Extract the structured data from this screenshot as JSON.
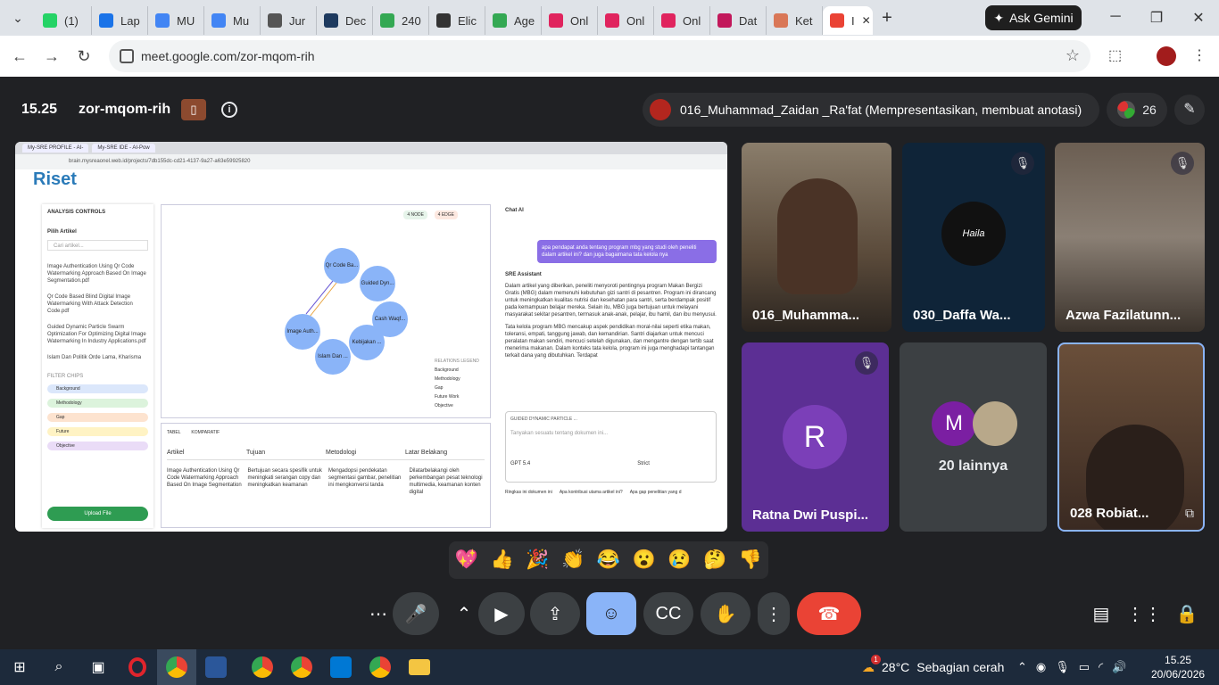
{
  "browser": {
    "tabs": [
      {
        "label": "(1)",
        "icon": "whatsapp-icon",
        "color": "#25d366"
      },
      {
        "label": "Lap",
        "icon": "drive-icon",
        "color": "#1a73e8"
      },
      {
        "label": "MU",
        "icon": "docs-icon",
        "color": "#4285f4"
      },
      {
        "label": "Mu",
        "icon": "docs-icon",
        "color": "#4285f4"
      },
      {
        "label": "Jur",
        "icon": "journal-icon",
        "color": "#555555"
      },
      {
        "label": "Dec",
        "icon": "shield-icon",
        "color": "#1e3a5f"
      },
      {
        "label": "240",
        "icon": "emoji-icon",
        "color": "#34a853"
      },
      {
        "label": "Elic",
        "icon": "elicit-icon",
        "color": "#333333"
      },
      {
        "label": "Age",
        "icon": "emoji-icon",
        "color": "#34a853"
      },
      {
        "label": "Onl",
        "icon": "v-icon",
        "color": "#e0245e"
      },
      {
        "label": "Onl",
        "icon": "v-icon",
        "color": "#e0245e"
      },
      {
        "label": "Onl",
        "icon": "v-icon",
        "color": "#e0245e"
      },
      {
        "label": "Dat",
        "icon": "m-icon",
        "color": "#c2185b"
      },
      {
        "label": "Ket",
        "icon": "spark-icon",
        "color": "#d97757"
      },
      {
        "label": "I",
        "icon": "record-icon",
        "color": "#ea4335",
        "active": true
      }
    ],
    "new_tab_glyph": "+",
    "gemini_label": "Ask Gemini",
    "url": "meet.google.com/zor-mqom-rih"
  },
  "meet": {
    "time": "15.25",
    "meeting_code": "zor-mqom-rih",
    "presenter_label": "016_Muhammad_Zaidan _Ra'fat (Mempresentasikan, membuat anotasi)",
    "people_count": "26"
  },
  "shared_screen": {
    "browser_tabs": [
      "My-SRE PROFILE - AI-",
      "My-SRE IDE - AI-Pow"
    ],
    "url": "brain.mysreaonel.web.id/projects/7db155dc-cd21-4137-9a27-a63e59925820",
    "logo": "Riset",
    "sidebar": {
      "title": "ANALYSIS CONTROLS",
      "pick_label": "Pilih Artikel",
      "search_placeholder": "Cari artikel...",
      "articles": [
        "Image Authentication Using Qr Code Watermarking Approach Based On Image Segmentation.pdf",
        "Qr Code Based Blind Digital Image Watermarking With Attack Detection Code.pdf",
        "Guided Dynamic Particle Swarm Optimization For Optimizing Digital Image Watermarking In Industry Applications.pdf",
        "Islam Dan Politik Orde Lama, Kharisma Politik Islam Dasar"
      ],
      "filter_title": "FILTER CHIPS",
      "chips": [
        {
          "label": "Background",
          "color": "#dbe7fb"
        },
        {
          "label": "Methodology",
          "color": "#dcf3dc"
        },
        {
          "label": "Gap",
          "color": "#fde3cf"
        },
        {
          "label": "Future",
          "color": "#fff3c4"
        },
        {
          "label": "Objective",
          "color": "#eadcf7"
        }
      ],
      "upload_label": "Upload File"
    },
    "graph": {
      "badges": [
        "4 NODE",
        "4 EDGE"
      ],
      "nodes": [
        "Qr Code Ba...",
        "Guided Dyn...",
        "Cash Waqf...",
        "Image Auth...",
        "Kebijakan ...",
        "Islam Dan ..."
      ],
      "legend_title": "RELATIONS LEGEND",
      "legend": [
        "Background",
        "Methodology",
        "Gap",
        "Future Work",
        "Objective"
      ]
    },
    "table": {
      "tabs": [
        "TABEL",
        "KOMPARATIF"
      ],
      "columns": [
        "Artikel",
        "Tujuan",
        "Metodologi",
        "Latar Belakang"
      ],
      "row": [
        "Image Authentication Using Qr Code Watermarking Approach Based On Image Segmentation",
        "Bertujuan secara spesifik untuk meningkati serangan copy dan meningkatkan keamanan",
        "Mengadopsi pendekatan segmentasi gambar, penelitian ini mengkonversi tanda",
        "Dilatarbelakangi oleh perkembangan pesat teknologi multimedia, keamanan konten digital"
      ]
    },
    "chat": {
      "title": "Chat AI",
      "question": "apa pendapat anda tentang program mbg yang studi oleh peneliti dalam artikel ini? dan juga bagaimana tata kelola nya",
      "assistant_label": "SRE Assistant",
      "answer_1": "Dalam artikel yang diberikan, peneliti menyoroti pentingnya program Makan Bergizi Gratis (MBG) dalam memenuhi kebutuhan gizi santri di pesantren. Program ini dirancang untuk meningkatkan kualitas nutrisi dan kesehatan para santri, serta berdampak positif pada kemampuan belajar mereka. Selain itu, MBG juga bertujuan untuk melayani masyarakat sekitar pesantren, termasuk anak-anak, pelajar, ibu hamil, dan ibu menyusui.",
      "answer_2": "Tata kelola program MBG mencakup aspek pendidikan moral-nilai seperti etika makan, toleransi, empati, tanggung jawab, dan kemandirian. Santri diajarkan untuk mencuci peralatan makan sendiri, mencuci setelah digunakan, dan mengantre dengan tertib saat menerima makanan. Dalam konteks tata kelola, program ini juga menghadapi tantangan terkait dana yang dibutuhkan. Terdapat",
      "context_chip": "GUIDED DYNAMIC PARTICLE ...",
      "input_placeholder": "Tanyakan sesuatu tentang dokumen ini...",
      "model": "GPT 5.4",
      "mode": "Strict",
      "suggestions": [
        "Ringkas ini dokumen ini",
        "Apa kontribusi utama artikel ini?",
        "Apa gap penelitian yang d"
      ]
    }
  },
  "participants": [
    {
      "name": "016_Muhamma...",
      "muted": false
    },
    {
      "name": "030_Daffa Wa...",
      "muted": true,
      "avatar_text": "Haila"
    },
    {
      "name": "Azwa Fazilatunn...",
      "muted": true
    },
    {
      "name": "Ratna Dwi Puspi...",
      "muted": true,
      "initial": "R",
      "avatar_color": "#7b3fb8"
    },
    {
      "name": "20 lainnya",
      "initial": "M",
      "avatar_color": "#7b1fa2"
    },
    {
      "name": "028 Robiat...",
      "muted": false
    }
  ],
  "reactions": [
    "💖",
    "👍",
    "🎉",
    "👏",
    "😂",
    "😮",
    "😢",
    "🤔",
    "👎"
  ],
  "taskbar": {
    "weather_badge": "1",
    "weather": "28°C",
    "weather_text": "Sebagian cerah",
    "time": "15.25",
    "date": "20/06/2026"
  }
}
